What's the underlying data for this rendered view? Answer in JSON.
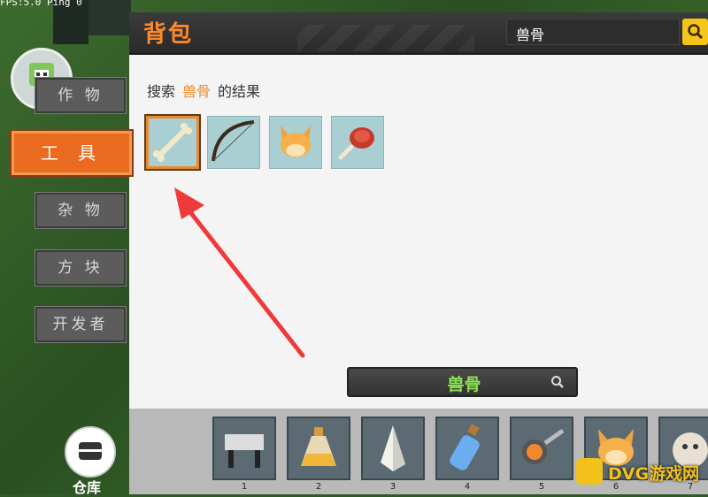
{
  "status_bar": {
    "fps_text": "FPS:5.0  Ping 0"
  },
  "header": {
    "title": "背包",
    "search_value": "兽骨"
  },
  "results": {
    "prefix": "搜索",
    "keyword": "兽骨",
    "suffix": "的结果"
  },
  "result_items": [
    {
      "icon": "bone-icon",
      "selected": true
    },
    {
      "icon": "bow-icon",
      "selected": false
    },
    {
      "icon": "fox-mask-icon",
      "selected": false
    },
    {
      "icon": "meat-leg-icon",
      "selected": false
    }
  ],
  "sidebar": {
    "categories": [
      {
        "label": "作 物",
        "active": false
      },
      {
        "label": "工 具",
        "active": true
      },
      {
        "label": "杂 物",
        "active": false
      },
      {
        "label": "方 块",
        "active": false
      },
      {
        "label": "开发者",
        "active": false
      }
    ],
    "warehouse_label": "仓库"
  },
  "bottom_search": {
    "value": "兽骨"
  },
  "hotbar": {
    "slots": [
      {
        "num": "1",
        "icon": "workbench-icon"
      },
      {
        "num": "2",
        "icon": "potion-bottle-icon"
      },
      {
        "num": "3",
        "icon": "white-shard-icon"
      },
      {
        "num": "4",
        "icon": "blue-bottle-icon"
      },
      {
        "num": "5",
        "icon": "frying-pan-icon"
      },
      {
        "num": "6",
        "icon": "fox-mask-icon"
      },
      {
        "num": "7",
        "icon": "creature-icon"
      }
    ]
  },
  "watermark": {
    "text": "DVG游戏网"
  },
  "colors": {
    "accent": "#ea6b1f",
    "keyword": "#f08a2c",
    "search_green": "#8be34f",
    "search_button": "#f7c51a"
  }
}
